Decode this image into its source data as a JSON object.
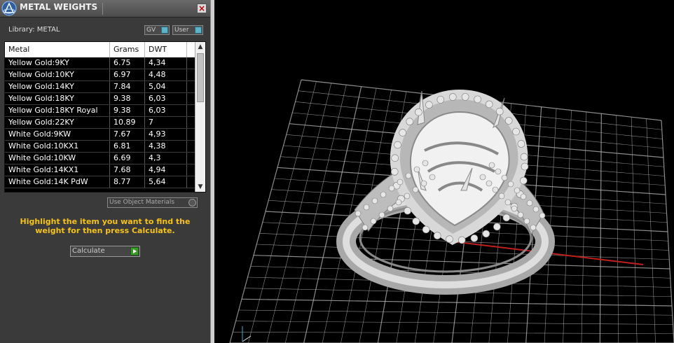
{
  "panel": {
    "title": "METAL WEIGHTS",
    "close_glyph": "×",
    "library_label": "Library: METAL",
    "toggles": [
      {
        "label": "GV"
      },
      {
        "label": "User"
      }
    ],
    "table": {
      "columns": [
        "Metal",
        "Grams",
        "DWT"
      ],
      "rows": [
        [
          "Yellow Gold:9KY",
          "6.75",
          "4,34"
        ],
        [
          "Yellow Gold:10KY",
          "6.97",
          "4,48"
        ],
        [
          "Yellow Gold:14KY",
          "7.84",
          "5,04"
        ],
        [
          "Yellow Gold:18KY",
          "9.38",
          "6,03"
        ],
        [
          "Yellow Gold:18KY Royal",
          "9.38",
          "6,03"
        ],
        [
          "Yellow Gold:22KY",
          "10.89",
          "7"
        ],
        [
          "White Gold:9KW",
          "7.67",
          "4,93"
        ],
        [
          "White Gold:10KX1",
          "6.81",
          "4,38"
        ],
        [
          "White Gold:10KW",
          "6.69",
          "4,3"
        ],
        [
          "White Gold:14KX1",
          "7.68",
          "4,94"
        ],
        [
          "White Gold:14K PdW",
          "8.77",
          "5,64"
        ]
      ]
    },
    "use_object_materials": "Use Object Materials",
    "hint": "Highlight the item you want to find the weight for then press Calculate.",
    "calculate_label": "Calculate"
  },
  "viewport": {
    "grid_color": "#b9b9b9",
    "axis_x_color": "#c0201c",
    "axis_y_color": "#2bb0c7",
    "model_color": "#cfcfcf"
  },
  "icons": {
    "logo": "app-logo-icon",
    "close": "close-icon",
    "toggle": "toggle-indicator-icon",
    "scroll_up": "scroll-up-icon",
    "scroll_down": "scroll-down-icon",
    "checkbox": "checkbox-icon",
    "calculate": "play-arrow-icon"
  }
}
